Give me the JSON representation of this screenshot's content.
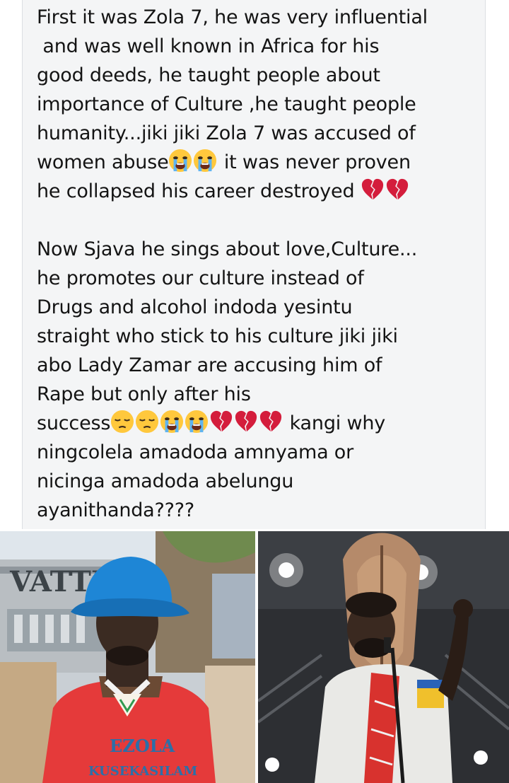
{
  "post": {
    "paragraph1": {
      "line1": "First it was Zola 7, he was very influential",
      "line2": " and was well known in Africa for his",
      "line3": "good deeds, he taught people about",
      "line4": "importance of Culture ,he taught people",
      "line5": "humanity...jiki jiki Zola 7 was accused of",
      "line6a": "women abuse",
      "line6b": " it was never proven",
      "line7": "he collapsed his career destroyed "
    },
    "paragraph2": {
      "line1": "Now Sjava he sings about love,Culture...",
      "line2": "he promotes our culture instead of",
      "line3": "Drugs and alcohol indoda yesintu",
      "line4": "straight who stick to his culture jiki jiki",
      "line5": "abo Lady Zamar are accusing him of",
      "line6": "Rape but only after his",
      "line7a": "success",
      "line7b": " kangi why",
      "line8": "ningcolela amadoda amnyama or",
      "line9": "nicinga amadoda abelungu",
      "line10": "ayanithanda????"
    }
  },
  "photos": {
    "left": {
      "sign_text": "VATTER",
      "shirt_text_line1": "EZOLA",
      "shirt_text_line2": "KUSEKASILAM"
    }
  },
  "icons": {
    "emoji_crying": "loudly-crying-face",
    "emoji_broken_heart": "broken-heart",
    "emoji_pensive": "pensive-face"
  },
  "colors": {
    "card_background": "#f4f5f6",
    "text": "#141414",
    "bucket_hat": "#1e86d6",
    "shirt_red": "#e53a3a",
    "heart_red": "#d41d3c",
    "emoji_yellow": "#ffc83d"
  }
}
